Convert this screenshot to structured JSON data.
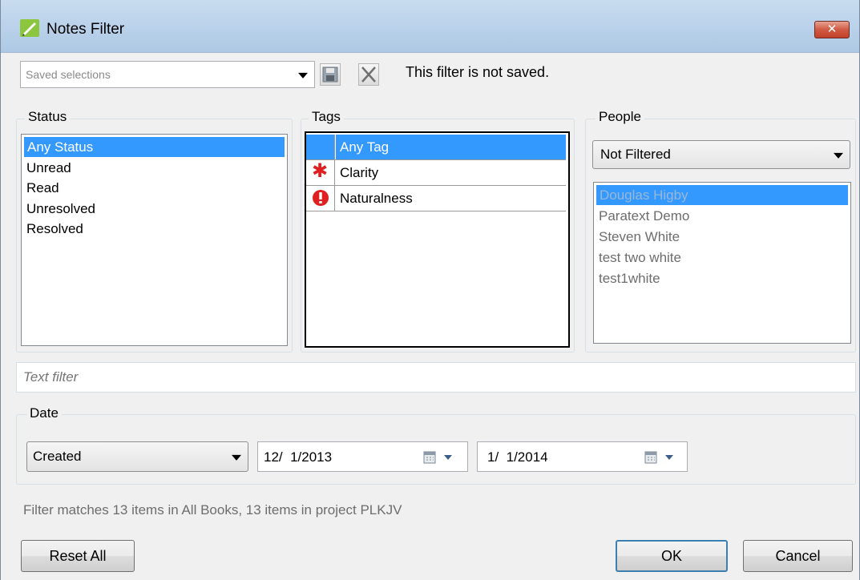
{
  "window": {
    "title": "Notes Filter",
    "close_symbol": "✕"
  },
  "saved": {
    "placeholder": "Saved selections",
    "status_text": "This filter is not saved."
  },
  "status": {
    "label": "Status",
    "items": [
      "Any Status",
      "Unread",
      "Read",
      "Unresolved",
      "Resolved"
    ],
    "selected": "Any Status"
  },
  "tags": {
    "label": "Tags",
    "items": [
      {
        "name": "Any Tag",
        "icon": "none"
      },
      {
        "name": "Clarity",
        "icon": "asterisk-icon"
      },
      {
        "name": "Naturalness",
        "icon": "exclamation-icon"
      }
    ],
    "selected": "Any Tag"
  },
  "people": {
    "label": "People",
    "filter_value": "Not Filtered",
    "items": [
      "Douglas Higby",
      "Paratext Demo",
      "Steven White",
      "test two white",
      "test1white"
    ],
    "selected": "Douglas Higby"
  },
  "text_filter": {
    "placeholder": "Text filter"
  },
  "date": {
    "label": "Date",
    "type_value": "Created",
    "from": "12/  1/2013",
    "to": "1/  1/2014"
  },
  "summary": "Filter matches 13 items in All Books, 13 items in project PLKJV",
  "buttons": {
    "reset": "Reset All",
    "ok": "OK",
    "cancel": "Cancel"
  },
  "colors": {
    "selection": "#3399ff",
    "accent_red": "#e02020"
  }
}
